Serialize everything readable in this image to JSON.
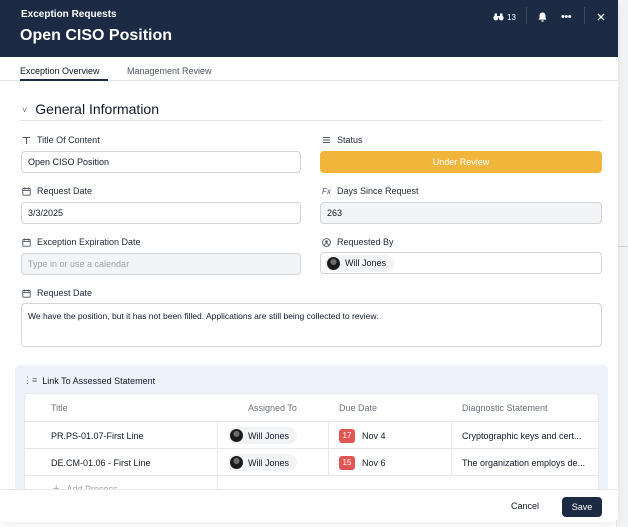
{
  "header": {
    "eyebrow": "Exception Requests",
    "title": "Open CISO Position",
    "watchers_count": "13",
    "watchers_icon": "binoculars-icon",
    "bell_icon": "bell-icon",
    "more_icon": "more-horizontal-icon",
    "close_icon": "close-icon"
  },
  "tabs": [
    {
      "label": "Exception Overview",
      "active": true
    },
    {
      "label": "Management Review",
      "active": false
    }
  ],
  "section": {
    "title": "General Information",
    "collapse_icon": "chevron-down-icon"
  },
  "fields": {
    "title_of_content": {
      "label": "Title Of Content",
      "icon": "text-icon",
      "value": "Open CISO Position"
    },
    "status": {
      "label": "Status",
      "icon": "list-icon",
      "value": "Under Review",
      "color": "#f2b53b"
    },
    "request_date": {
      "label": "Request Date",
      "icon": "calendar-icon",
      "value": "3/3/2025"
    },
    "days_since_request": {
      "label": "Days Since Request",
      "icon": "formula-icon",
      "icon_text": "Fx",
      "value": "263"
    },
    "exception_expiration_date": {
      "label": "Exception Expiration Date",
      "icon": "calendar-icon",
      "placeholder": "Type in or use a calendar"
    },
    "requested_by": {
      "label": "Requested By",
      "icon": "user-circle-icon",
      "value": "Will Jones"
    },
    "request_details": {
      "label": "Request Date",
      "icon": "calendar-icon",
      "value": "We have the position, but it has not been filled. Applications are still being collected to review."
    }
  },
  "link_section": {
    "title": "Link To Assessed Statement",
    "icon": "link-list-icon",
    "columns": [
      "Title",
      "Assigned To",
      "Due Date",
      "Diagnostic Statement"
    ],
    "rows": [
      {
        "title": "PR.PS-01.07-First Line",
        "assigned_to": "Will Jones",
        "due_days": "17",
        "due_date": "Nov 4",
        "diagnostic": "Cryptographic keys and cert..."
      },
      {
        "title": "DE.CM-01.06 - First Line",
        "assigned_to": "Will Jones",
        "due_days": "15",
        "due_date": "Nov 6",
        "diagnostic": "The organization employs de..."
      }
    ],
    "add_label": "Add Process"
  },
  "footer": {
    "cancel_label": "Cancel",
    "save_label": "Save"
  },
  "colors": {
    "header_bg": "#1c2a44",
    "status": "#f2b53b",
    "due_badge": "#e25555",
    "panel_bg": "#eef3fb"
  }
}
